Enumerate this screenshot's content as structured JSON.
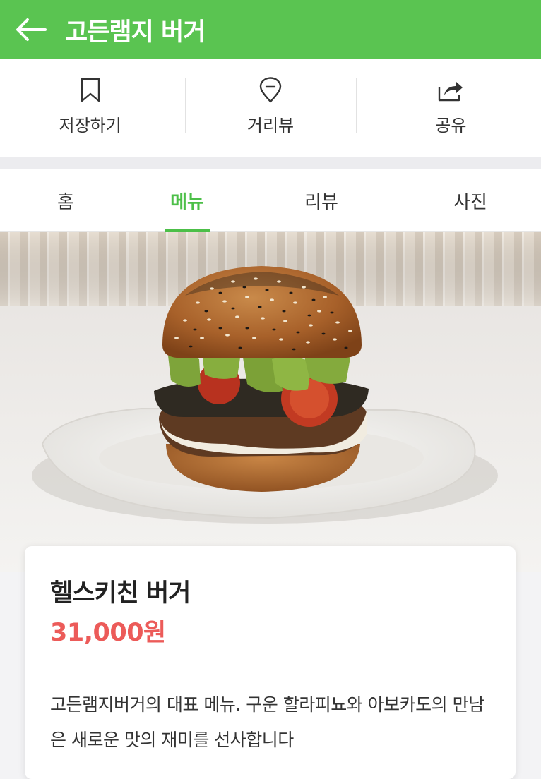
{
  "header": {
    "title": "고든램지 버거",
    "back_icon": "arrow-left-icon"
  },
  "actions": [
    {
      "label": "저장하기",
      "icon": "bookmark-icon"
    },
    {
      "label": "거리뷰",
      "icon": "location-pin-icon"
    },
    {
      "label": "공유",
      "icon": "share-icon"
    }
  ],
  "tabs": [
    {
      "label": "홈",
      "active": false
    },
    {
      "label": "메뉴",
      "active": true
    },
    {
      "label": "리뷰",
      "active": false
    },
    {
      "label": "사진",
      "active": false
    }
  ],
  "menu_item": {
    "name": "헬스키친 버거",
    "price": "31,000원",
    "description": "고든램지버거의 대표 메뉴. 구운 할라피뇨와 아보카도의 만남은 새로운 맛의 재미를 선사합니다"
  },
  "colors": {
    "brand_green": "#5ac451",
    "tab_active": "#4cbf48",
    "price_red": "#ec5b59"
  }
}
